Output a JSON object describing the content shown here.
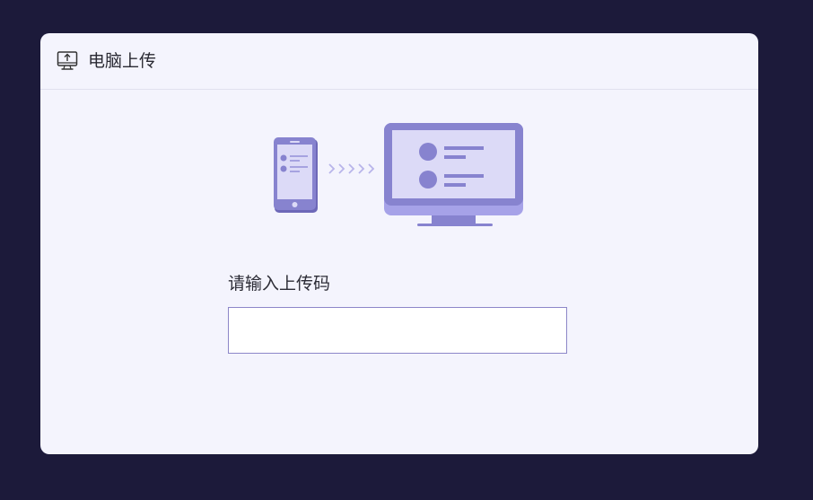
{
  "dialog": {
    "title": "电脑上传",
    "header_icon": "computer-upload-icon"
  },
  "illustration": {
    "from_icon": "phone-icon",
    "arrows": "transfer-arrows-icon",
    "to_icon": "monitor-icon"
  },
  "form": {
    "code_label": "请输入上传码",
    "code_value": "",
    "code_placeholder": ""
  },
  "colors": {
    "backdrop": "#1c1a3a",
    "dialog_bg": "#f4f4fd",
    "illustration_primary": "#8783cf",
    "illustration_light": "#dcdaf7",
    "input_border": "#8c86c8"
  }
}
